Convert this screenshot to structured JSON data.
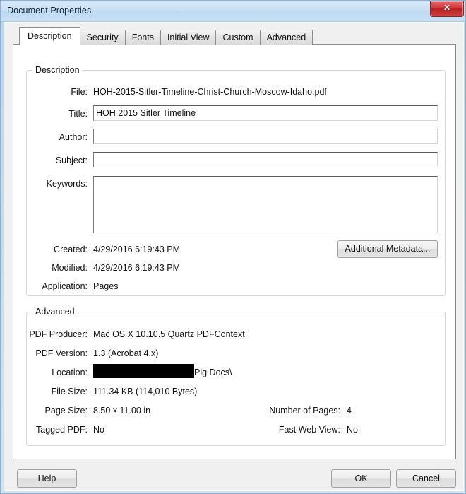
{
  "window": {
    "title": "Document Properties",
    "close_label": "✕",
    "accent_titlebar": "#c6dff3",
    "close_button_color": "#c62b2b"
  },
  "tabs": [
    {
      "label": "Description",
      "active": true
    },
    {
      "label": "Security",
      "active": false
    },
    {
      "label": "Fonts",
      "active": false
    },
    {
      "label": "Initial View",
      "active": false
    },
    {
      "label": "Custom",
      "active": false
    },
    {
      "label": "Advanced",
      "active": false
    }
  ],
  "description": {
    "legend": "Description",
    "file_label": "File:",
    "file_value": "HOH-2015-Sitler-Timeline-Christ-Church-Moscow-Idaho.pdf",
    "title_label": "Title:",
    "title_value": "HOH 2015 Sitler Timeline",
    "author_label": "Author:",
    "author_value": "",
    "subject_label": "Subject:",
    "subject_value": "",
    "keywords_label": "Keywords:",
    "keywords_value": "",
    "created_label": "Created:",
    "created_value": "4/29/2016 6:19:43 PM",
    "modified_label": "Modified:",
    "modified_value": "4/29/2016 6:19:43 PM",
    "application_label": "Application:",
    "application_value": "Pages",
    "additional_metadata_label": "Additional Metadata..."
  },
  "advanced": {
    "legend": "Advanced",
    "pdf_producer_label": "PDF Producer:",
    "pdf_producer_value": "Mac OS X 10.10.5 Quartz PDFContext",
    "pdf_version_label": "PDF Version:",
    "pdf_version_value": "1.3 (Acrobat 4.x)",
    "location_label": "Location:",
    "location_value": "Pig Docs\\",
    "file_size_label": "File Size:",
    "file_size_value": "111.34 KB (114,010 Bytes)",
    "page_size_label": "Page Size:",
    "page_size_value": "8.50 x 11.00 in",
    "number_of_pages_label": "Number of Pages:",
    "number_of_pages_value": "4",
    "tagged_pdf_label": "Tagged PDF:",
    "tagged_pdf_value": "No",
    "fast_web_view_label": "Fast Web View:",
    "fast_web_view_value": "No"
  },
  "footer": {
    "help_label": "Help",
    "ok_label": "OK",
    "cancel_label": "Cancel"
  }
}
